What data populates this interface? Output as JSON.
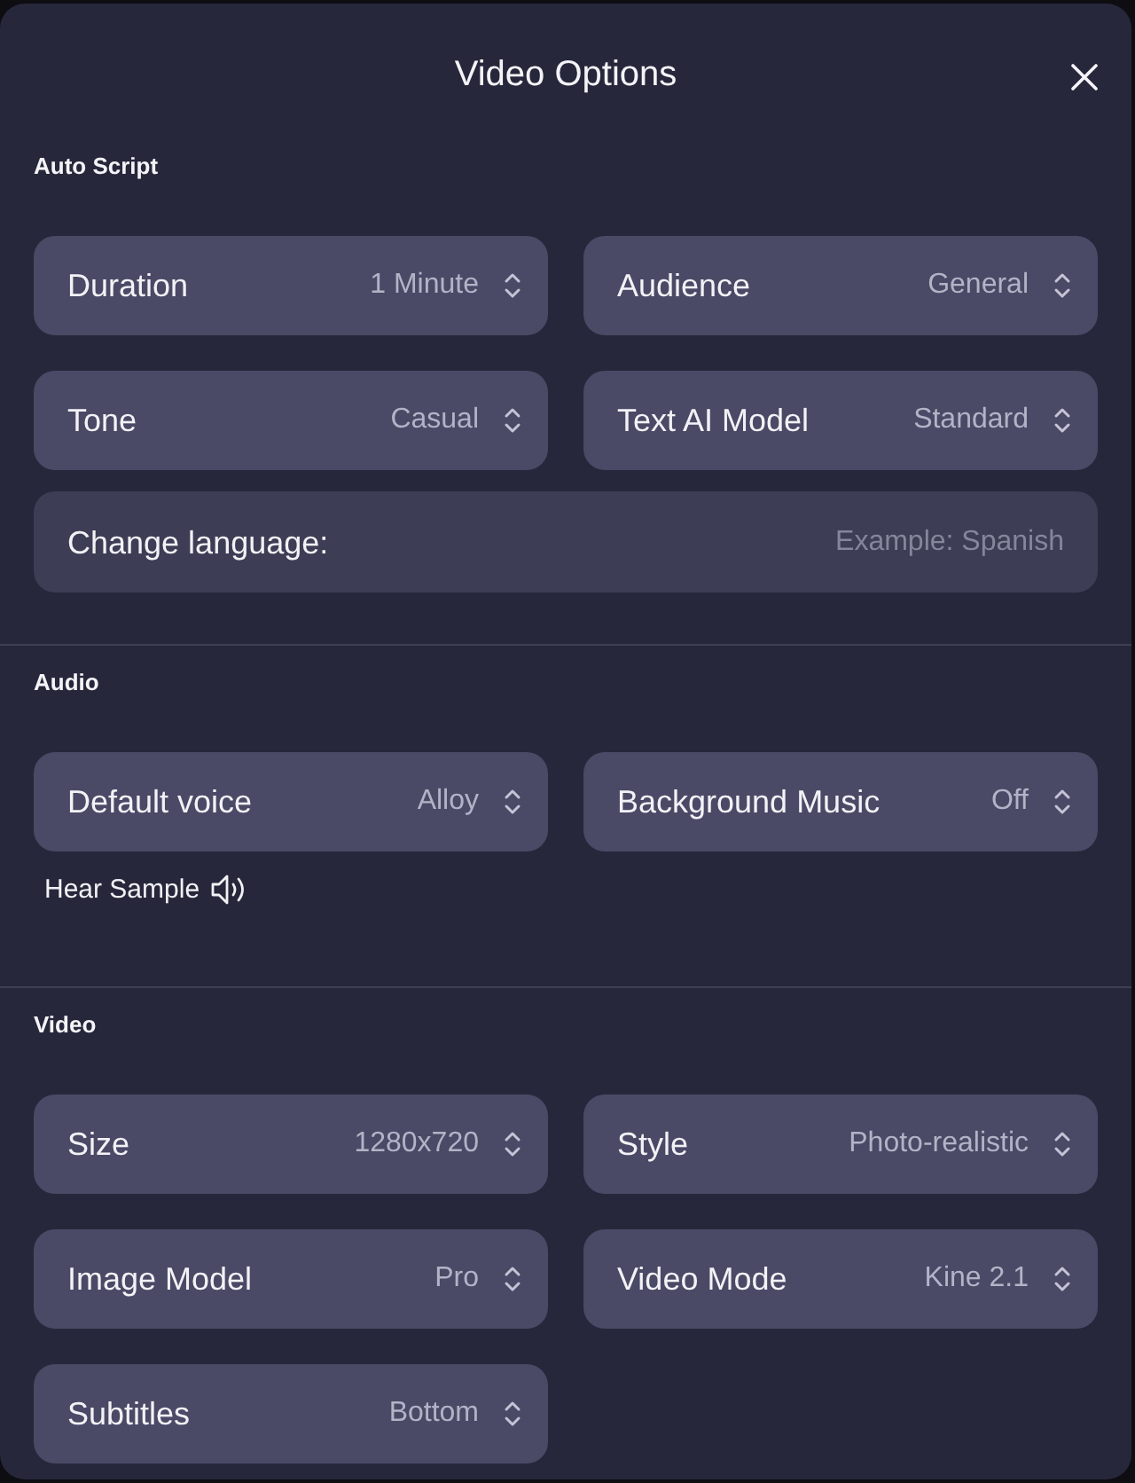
{
  "dialog": {
    "title": "Video Options"
  },
  "sections": [
    {
      "heading": "Auto Script",
      "fields": [
        {
          "kind": "select",
          "label": "Duration",
          "value": "1 Minute"
        },
        {
          "kind": "select",
          "label": "Audience",
          "value": "General"
        },
        {
          "kind": "select",
          "label": "Tone",
          "value": "Casual"
        },
        {
          "kind": "select",
          "label": "Text AI Model",
          "value": "Standard"
        },
        {
          "kind": "text",
          "label": "Change language:",
          "placeholder": "Example: Spanish"
        }
      ]
    },
    {
      "heading": "Audio",
      "fields": [
        {
          "kind": "select",
          "label": "Default voice",
          "value": "Alloy"
        },
        {
          "kind": "select",
          "label": "Background Music",
          "value": "Off"
        }
      ],
      "action": {
        "label": "Hear Sample"
      }
    },
    {
      "heading": "Video",
      "fields": [
        {
          "kind": "select",
          "label": "Size",
          "value": "1280x720"
        },
        {
          "kind": "select",
          "label": "Style",
          "value": "Photo-realistic"
        },
        {
          "kind": "select",
          "label": "Image Model",
          "value": "Pro"
        },
        {
          "kind": "select",
          "label": "Video Mode",
          "value": "Kine 2.1"
        },
        {
          "kind": "select",
          "label": "Subtitles",
          "value": "Bottom"
        }
      ]
    }
  ]
}
